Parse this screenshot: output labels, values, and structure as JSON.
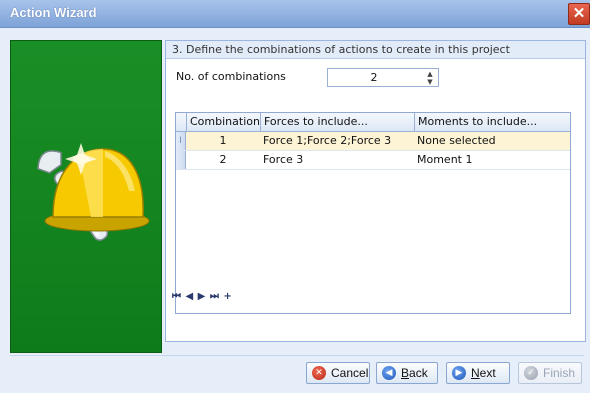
{
  "window": {
    "title": "Action Wizard",
    "close_symbol": "✕"
  },
  "step": {
    "heading": "3. Define the combinations of actions to create in this project"
  },
  "combinations": {
    "label": "No. of combinations",
    "value": "2"
  },
  "grid": {
    "columns": [
      "Combination",
      "Forces to include...",
      "Moments to include..."
    ],
    "rows": [
      {
        "combination": "1",
        "forces": "Force 1;Force 2;Force 3",
        "moments": "None selected",
        "selected": true
      },
      {
        "combination": "2",
        "forces": "Force 3",
        "moments": "Moment 1",
        "selected": false
      }
    ],
    "row_indicator": "I",
    "navigator": {
      "first": "⏮",
      "prev": "◀",
      "next": "▶",
      "last": "⏭",
      "add": "+"
    }
  },
  "buttons": {
    "cancel": {
      "prefix": "",
      "underlined": "",
      "rest": "Cancel"
    },
    "back": {
      "prefix": "",
      "underlined": "B",
      "rest": "ack"
    },
    "next": {
      "prefix": "",
      "underlined": "N",
      "rest": "ext"
    },
    "finish": {
      "prefix": "",
      "underlined": "",
      "rest": "Finish"
    }
  },
  "colors": {
    "sidebar_green": "#138420",
    "accent_blue": "#1f57b8",
    "selected_row": "#fcf4d5"
  }
}
